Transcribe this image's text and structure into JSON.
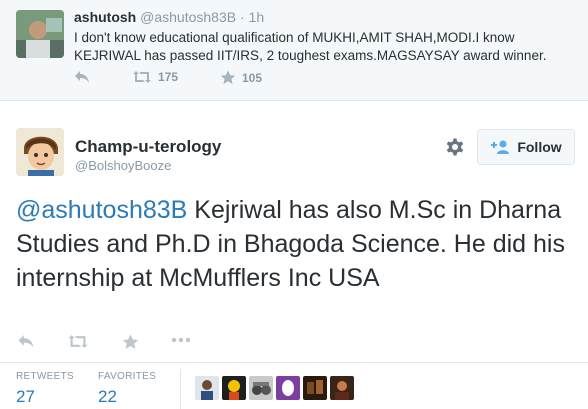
{
  "parent_tweet": {
    "name": "ashutosh",
    "handle": "@ashutosh83B",
    "separator": "·",
    "time": "1h",
    "text": "I don't know educational qualification of MUKHI,AMIT SHAH,MODI.I know KEJRIWAL has passed IIT/IRS, 2 toughest exams.MAGSAYSAY award winner.",
    "retweet_count": "175",
    "favorite_count": "105",
    "icons": [
      "reply-icon",
      "retweet-icon",
      "favorite-icon"
    ]
  },
  "tweet": {
    "name": "Champ-u-terology",
    "handle": "@BolshoyBooze",
    "follow_label": "Follow",
    "mention": "@ashutosh83B",
    "text": " Kejriwal has also M.Sc in Dharna Studies and Ph.D in Bhagoda Science. He did his internship at McMufflers Inc USA",
    "icons": [
      "gear-icon",
      "follow-person-icon",
      "reply-icon",
      "retweet-icon",
      "favorite-icon",
      "more-icon"
    ]
  },
  "stats": {
    "retweets_label": "RETWEETS",
    "retweets_value": "27",
    "favorites_label": "FAVORITES",
    "favorites_value": "22"
  },
  "colors": {
    "link": "#2b7bb9",
    "muted": "#8899a6",
    "text": "#292f33",
    "border": "#e1e8ed",
    "parent_bg": "#f5f8fa"
  }
}
